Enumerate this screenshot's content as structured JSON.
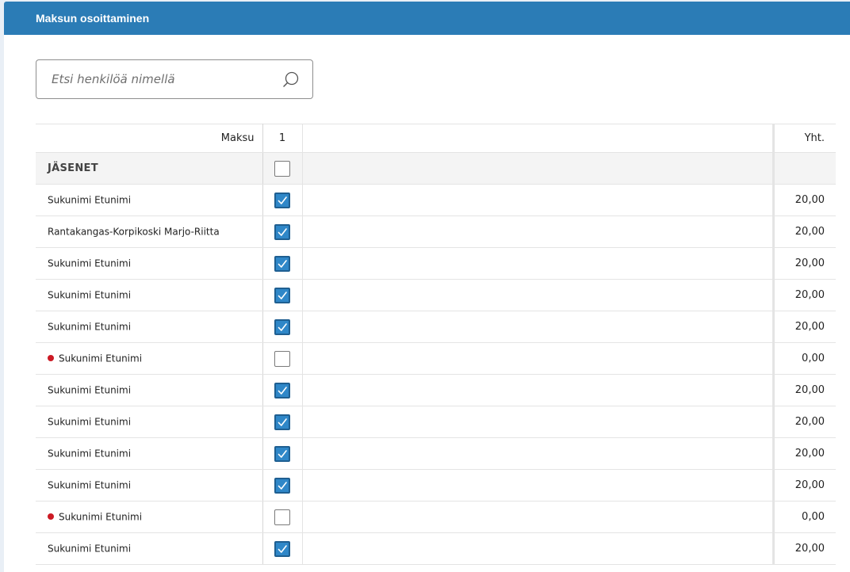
{
  "header": {
    "title": "Maksun osoittaminen",
    "color": "#2b7cb6"
  },
  "search": {
    "placeholder": "Etsi henkilöä nimellä",
    "value": "",
    "icon": "search-icon"
  },
  "table": {
    "payment_label": "Maksu",
    "payment_column": "1",
    "total_label": "Yht.",
    "group": {
      "label": "JÄSENET",
      "checked": false
    },
    "rows": [
      {
        "name": "Sukunimi Etunimi",
        "checked": true,
        "total": "20,00",
        "flag": false
      },
      {
        "name": "Rantakangas-Korpikoski Marjo-Riitta",
        "checked": true,
        "total": "20,00",
        "flag": false
      },
      {
        "name": "Sukunimi Etunimi",
        "checked": true,
        "total": "20,00",
        "flag": false
      },
      {
        "name": "Sukunimi Etunimi",
        "checked": true,
        "total": "20,00",
        "flag": false
      },
      {
        "name": "Sukunimi Etunimi",
        "checked": true,
        "total": "20,00",
        "flag": false
      },
      {
        "name": "Sukunimi Etunimi",
        "checked": false,
        "total": "0,00",
        "flag": true
      },
      {
        "name": "Sukunimi Etunimi",
        "checked": true,
        "total": "20,00",
        "flag": false
      },
      {
        "name": "Sukunimi Etunimi",
        "checked": true,
        "total": "20,00",
        "flag": false
      },
      {
        "name": "Sukunimi Etunimi",
        "checked": true,
        "total": "20,00",
        "flag": false
      },
      {
        "name": "Sukunimi Etunimi",
        "checked": true,
        "total": "20,00",
        "flag": false
      },
      {
        "name": "Sukunimi Etunimi",
        "checked": false,
        "total": "0,00",
        "flag": true
      },
      {
        "name": "Sukunimi Etunimi",
        "checked": true,
        "total": "20,00",
        "flag": false
      }
    ]
  },
  "colors": {
    "checkbox_checked": "#2f87c8",
    "flag_dot": "#cc1a24",
    "group_background": "#f4f4f4"
  }
}
